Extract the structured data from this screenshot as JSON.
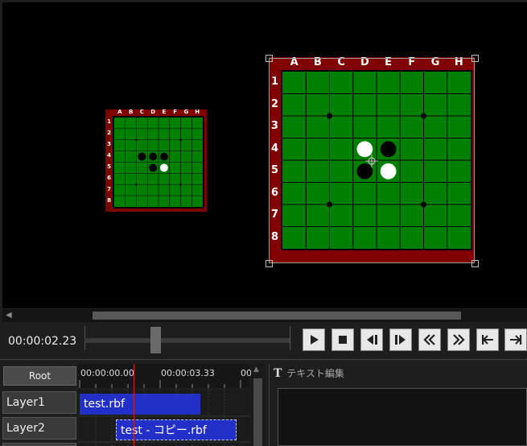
{
  "preview": {
    "boards": [
      {
        "id": "small",
        "columns": [
          "A",
          "B",
          "C",
          "D",
          "E",
          "F",
          "G",
          "H"
        ],
        "rows": [
          "1",
          "2",
          "3",
          "4",
          "5",
          "6",
          "7",
          "8"
        ],
        "stones": [
          {
            "col": "C",
            "row": "4",
            "color": "black"
          },
          {
            "col": "D",
            "row": "4",
            "color": "black"
          },
          {
            "col": "E",
            "row": "4",
            "color": "black"
          },
          {
            "col": "D",
            "row": "5",
            "color": "black"
          },
          {
            "col": "E",
            "row": "5",
            "color": "white"
          }
        ]
      },
      {
        "id": "large",
        "columns": [
          "A",
          "B",
          "C",
          "D",
          "E",
          "F",
          "G",
          "H"
        ],
        "rows": [
          "1",
          "2",
          "3",
          "4",
          "5",
          "6",
          "7",
          "8"
        ],
        "stones": [
          {
            "col": "D",
            "row": "4",
            "color": "white"
          },
          {
            "col": "E",
            "row": "4",
            "color": "black"
          },
          {
            "col": "D",
            "row": "5",
            "color": "black"
          },
          {
            "col": "E",
            "row": "5",
            "color": "white"
          }
        ]
      }
    ],
    "colors": {
      "frame": "#800000",
      "board": "#008000",
      "grid": "#000000"
    }
  },
  "transport": {
    "time": "00:00:02.23",
    "buttons": [
      "play",
      "stop",
      "prev-frame",
      "next-frame",
      "rewind",
      "fast-forward",
      "go-start",
      "go-end"
    ]
  },
  "timeline": {
    "root_label": "Root",
    "ruler": [
      "00:00:00.00",
      "00:00:03.33",
      "00"
    ],
    "layers": [
      {
        "name": "Layer1",
        "clip": "test.rbf"
      },
      {
        "name": "Layer2",
        "clip": "test - コピー.rbf"
      }
    ],
    "clip_color": "#2330c8"
  },
  "text_panel": {
    "title": "テキスト編集",
    "icon": "text-tool-icon"
  }
}
